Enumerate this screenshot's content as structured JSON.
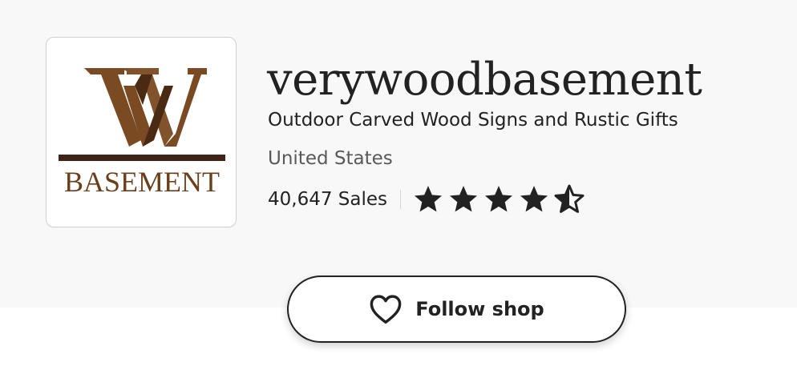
{
  "shop": {
    "name": "verywoodbasement",
    "tagline": "Outdoor Carved Wood Signs and Rustic Gifts",
    "location": "United States",
    "sales": "40,647 Sales",
    "rating": 4.5,
    "rating_max": 5
  },
  "logo": {
    "letter_left": "W",
    "letter_right": "W",
    "wordmark": "BASEMENT",
    "colors": {
      "wood_light": "#7a4a22",
      "wood_dark": "#4a2a12"
    }
  },
  "follow": {
    "label": "Follow shop",
    "icon": "heart-outline-icon"
  },
  "colors": {
    "band_background": "#f8f8f8",
    "text_primary": "#222222",
    "text_secondary": "#595959",
    "star_color": "#222222"
  }
}
